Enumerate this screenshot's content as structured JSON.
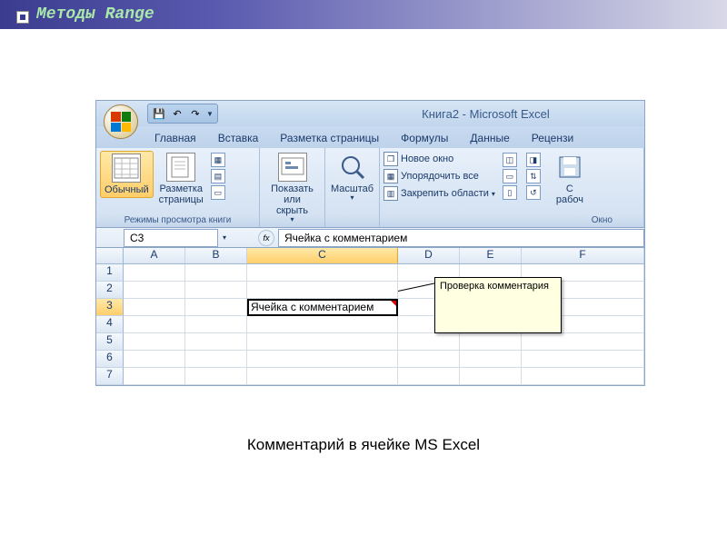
{
  "slide": {
    "title": "Методы Range"
  },
  "titlebar": {
    "text": "Книга2 - Microsoft Excel"
  },
  "qat": {
    "save": "💾",
    "undo": "↶",
    "redo": "↷"
  },
  "tabs": [
    "Главная",
    "Вставка",
    "Разметка страницы",
    "Формулы",
    "Данные",
    "Рецензи"
  ],
  "ribbon": {
    "view_modes": {
      "normal": "Обычный",
      "page_layout": "Разметка\nстраницы",
      "label": "Режимы просмотра книги"
    },
    "show_hide": "Показать\nили скрыть",
    "zoom": "Масштаб",
    "window": {
      "new_window": "Новое окно",
      "arrange_all": "Упорядочить все",
      "freeze": "Закрепить области",
      "save_ws": "С\nрабоч",
      "label": "Окно"
    }
  },
  "formula_bar": {
    "name_box": "C3",
    "fx_label": "fx",
    "value": "Ячейка с комментарием"
  },
  "columns": [
    "A",
    "B",
    "C",
    "D",
    "E",
    "F"
  ],
  "rows": [
    "1",
    "2",
    "3",
    "4",
    "5",
    "6",
    "7"
  ],
  "cell_value": "Ячейка с комментарием",
  "comment_text": "Проверка комментария",
  "caption": "Комментарий в ячейке MS Excel"
}
